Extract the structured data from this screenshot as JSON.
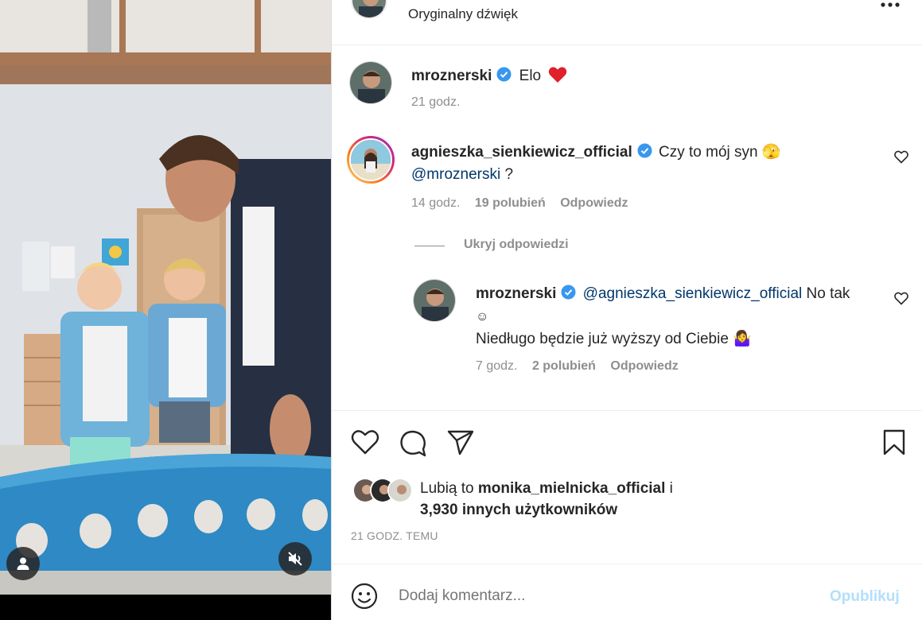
{
  "header": {
    "audio_label": "Oryginalny dźwięk"
  },
  "caption": {
    "username": "mroznerski",
    "text": "Elo",
    "time": "21 godz."
  },
  "comments": [
    {
      "username": "agnieszka_sienkiewicz_official",
      "text_line1": "Czy to mój syn 🫣",
      "mention": "@mroznerski",
      "text_after_mention": " ?",
      "time": "14 godz.",
      "likes": "19 polubień",
      "reply_label": "Odpowiedz"
    }
  ],
  "replies_toggle": "Ukryj odpowiedzi",
  "reply": {
    "username": "mroznerski",
    "mention": "@agnieszka_sienkiewicz_official",
    "text_after_mention": " No tak",
    "emoji_line": "☺",
    "line2": "Niedługo będzie już wyższy od Ciebie 🤷‍♀️",
    "time": "7 godz.",
    "likes": "2 polubień",
    "reply_label": "Odpowiedz"
  },
  "likes": {
    "prefix": "Lubią to ",
    "user": "monika_mielnicka_official",
    "suffix": " i",
    "others": "3,930 innych użytkowników"
  },
  "post_time": "21 GODZ. TEMU",
  "comment_input": {
    "placeholder": "Dodaj komentarz...",
    "submit_label": "Opublikuj"
  },
  "colors": {
    "verified": "#3897f0",
    "link": "#00376b",
    "submit_disabled": "#b2dffc",
    "heart": "#ed4956"
  },
  "icons": [
    "more-icon",
    "verified-icon",
    "heart-icon",
    "comment-icon",
    "share-icon",
    "bookmark-icon",
    "emoji-icon",
    "user-tag-icon",
    "mute-icon"
  ]
}
